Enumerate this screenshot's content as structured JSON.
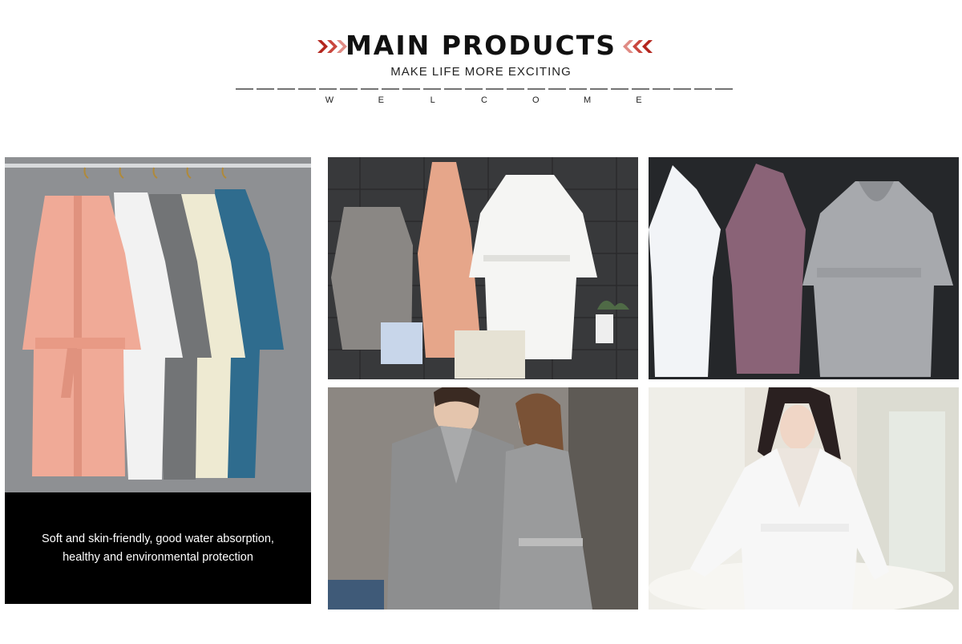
{
  "header": {
    "title": "MAIN PRODUCTS",
    "subtitle": "MAKE LIFE MORE EXCITING",
    "welcome_letters": [
      "W",
      "E",
      "L",
      "C",
      "O",
      "M",
      "E"
    ]
  },
  "panels": {
    "robes_rack_caption": "Soft and skin-friendly, good water absorption, healthy and environmental protection"
  },
  "colors": {
    "accent": "#b3261e",
    "caption_bg": "#000000"
  }
}
